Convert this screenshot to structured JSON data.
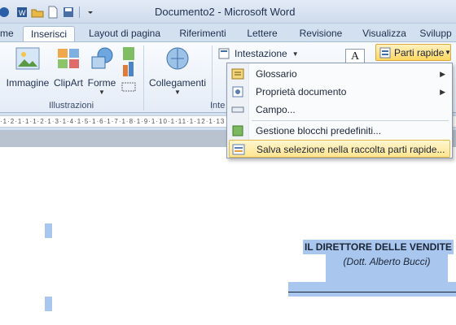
{
  "window": {
    "title": "Documento2 - Microsoft Word"
  },
  "tabs": [
    {
      "label": "me"
    },
    {
      "label": "Inserisci"
    },
    {
      "label": "Layout di pagina"
    },
    {
      "label": "Riferimenti"
    },
    {
      "label": "Lettere"
    },
    {
      "label": "Revisione"
    },
    {
      "label": "Visualizza"
    },
    {
      "label": "Svilupp"
    }
  ],
  "ribbon": {
    "illustrazioni": {
      "group_label": "Illustrazioni",
      "immagine": "Immagine",
      "clipart": "ClipArt",
      "forme": "Forme"
    },
    "collegamenti": {
      "label": "Collegamenti",
      "group_label": "Inte"
    },
    "intestazione": "Intestazione",
    "parti_rapide": "Parti rapide"
  },
  "menu": {
    "items": [
      {
        "label": "Glossario",
        "has_submenu": true
      },
      {
        "label": "Proprietà documento",
        "has_submenu": true
      },
      {
        "label": "Campo...",
        "has_submenu": false
      },
      {
        "label": "Gestione blocchi predefiniti...",
        "has_submenu": false
      },
      {
        "label": "Salva selezione nella raccolta parti rapide...",
        "has_submenu": false
      }
    ]
  },
  "ruler": {
    "marks": "·1·2·1·1·1·2·1·3·1·4·1·5·1·6·1·7·1·8·1·9·1·10·1·11·1·12·1·13"
  },
  "document": {
    "line1": "IL DIRETTORE DELLE VENDITE",
    "line2": "(Dott. Alberto Bucci)"
  },
  "colors": {
    "selection": "#a9c7ee",
    "highlight": "#ffe58f",
    "ribbon": "#e4ecf7"
  }
}
